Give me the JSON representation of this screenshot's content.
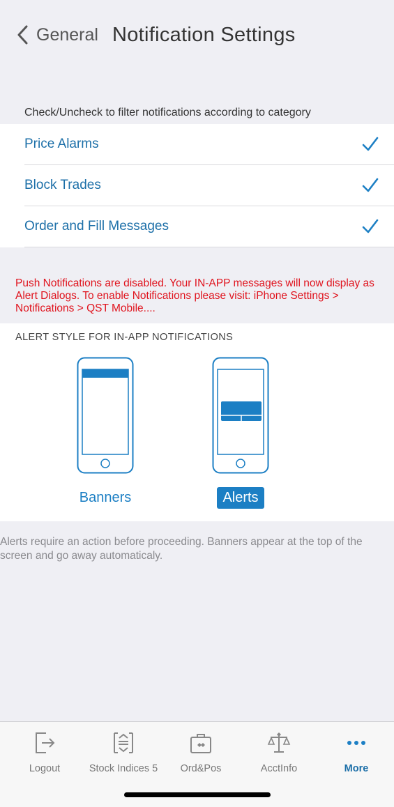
{
  "nav": {
    "back_label": "General",
    "title": "Notification Settings"
  },
  "categories": {
    "header": "Check/Uncheck to filter notifications according to category",
    "items": [
      {
        "label": "Price Alarms",
        "checked": true
      },
      {
        "label": "Block Trades",
        "checked": true
      },
      {
        "label": "Order and Fill Messages",
        "checked": true
      }
    ]
  },
  "warning": "Push Notifications are disabled. Your IN-APP messages will now display as Alert Dialogs. To enable Notifications please visit: iPhone Settings > Notifications > QST Mobile....",
  "alert_style": {
    "header": "ALERT STYLE FOR IN-APP NOTIFICATIONS",
    "options": [
      {
        "label": "Banners",
        "selected": false
      },
      {
        "label": "Alerts",
        "selected": true
      }
    ]
  },
  "footnote": "Alerts require an action before proceeding. Banners appear at the top of the screen and go away automaticaly.",
  "tabbar": {
    "tabs": [
      {
        "label": "Logout",
        "icon": "logout-icon",
        "active": false
      },
      {
        "label": "Stock Indices 5",
        "icon": "stock-indices-icon",
        "active": false
      },
      {
        "label": "Ord&Pos",
        "icon": "briefcase-icon",
        "active": false
      },
      {
        "label": "AcctInfo",
        "icon": "scale-icon",
        "active": false
      },
      {
        "label": "More",
        "icon": "more-dots-icon",
        "active": true
      }
    ]
  },
  "colors": {
    "accent": "#1c7fc4",
    "link": "#1c6fa8",
    "warning": "#e0141e",
    "background": "#efeff4"
  }
}
